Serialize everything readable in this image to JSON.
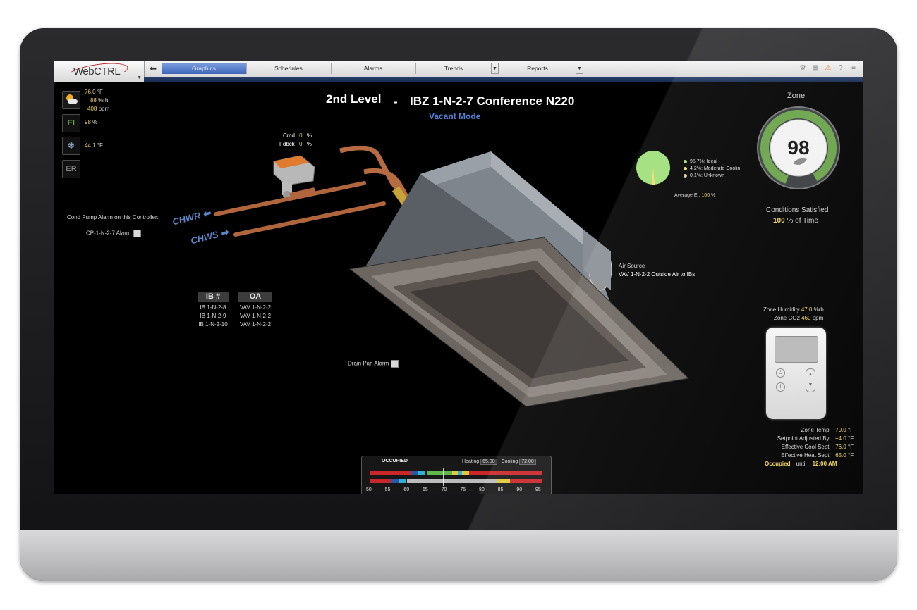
{
  "app": {
    "logo": "WebCTRL"
  },
  "nav": {
    "tabs": [
      {
        "label": "Graphics"
      },
      {
        "label": "Schedules"
      },
      {
        "label": "Alarms"
      },
      {
        "label": "Trends"
      },
      {
        "label": "Reports"
      }
    ]
  },
  "weather": {
    "temp_value": "76.0",
    "temp_unit": "°F",
    "humidity_value": "88",
    "humidity_unit": "%rh",
    "co2_value": "408",
    "co2_unit": "ppm",
    "ei_value": "98",
    "ei_unit": "%",
    "cool_value": "44.1",
    "cool_unit": "°F",
    "ei_label": "EI",
    "er_label": "ER"
  },
  "header": {
    "level": "2nd Level",
    "dash": "-",
    "zone_name": "IBZ 1-N-2-7 Conference N220",
    "mode": "Vacant Mode"
  },
  "valve": {
    "cmd_label": "Cmd",
    "cmd_value": "0",
    "cmd_unit": "%",
    "fdbck_label": "Fdbck",
    "fdbck_value": "0",
    "fdbck_unit": "%"
  },
  "pipes": {
    "chwr": "CHWR",
    "chws": "CHWS"
  },
  "cond_pump": {
    "label": "Cond Pump Alarm on this Controller:",
    "alarm_label": "CP-1-N-2-7 Alarm"
  },
  "ib_table": {
    "headers": [
      "IB #",
      "OA"
    ],
    "rows": [
      [
        "IB 1-N-2-8",
        "VAV 1-N-2-2"
      ],
      [
        "IB 1-N-2-9",
        "VAV 1-N-2-2"
      ],
      [
        "IB 1-N-2-10",
        "VAV 1-N-2-2"
      ]
    ]
  },
  "drain": {
    "label": "Drain Pan Alarm"
  },
  "pie": {
    "legend": [
      {
        "label": "95.7%: Ideal",
        "color": "#9fe07a"
      },
      {
        "label": "4.2%: Moderate Coolin",
        "color": "#f1e06a"
      },
      {
        "label": "0.1%: Unknown",
        "color": "#d8c8a8"
      }
    ],
    "avg_label": "Average EI:",
    "avg_value": "100",
    "avg_unit": "%"
  },
  "zone": {
    "title": "Zone",
    "score": "98",
    "satisfied_label": "Conditions Satisfied",
    "satisfied_value": "100",
    "satisfied_suffix": "% of Time"
  },
  "air_source": {
    "label": "Air Source",
    "value": "VAV 1-N-2-2 Outside Air to IBs"
  },
  "zone_env": {
    "humidity_label": "Zone Humidity",
    "humidity_value": "47.0",
    "humidity_unit": "%rh",
    "co2_label": "Zone CO2",
    "co2_value": "460",
    "co2_unit": "ppm"
  },
  "zone_stats": [
    {
      "label": "Zone Temp",
      "value": "70.0",
      "unit": "°F"
    },
    {
      "label": "Setpoint Adjusted By",
      "value": "+4.0",
      "unit": "°F"
    },
    {
      "label": "Effective Cool Sept",
      "value": "76.0",
      "unit": "°F"
    },
    {
      "label": "Effective Heat Sept",
      "value": "65.0",
      "unit": "°F"
    }
  ],
  "occupancy": {
    "status": "Occupied",
    "until_label": "until",
    "until_time": "12:00 AM"
  },
  "setpoint_scale": {
    "state": "OCCUPIED",
    "heating_label": "Heating",
    "heating_value": "65.00",
    "cooling_label": "Cooling",
    "cooling_value": "72.00",
    "ticks": [
      "50",
      "55",
      "60",
      "65",
      "70",
      "75",
      "80",
      "85",
      "90",
      "95"
    ]
  }
}
